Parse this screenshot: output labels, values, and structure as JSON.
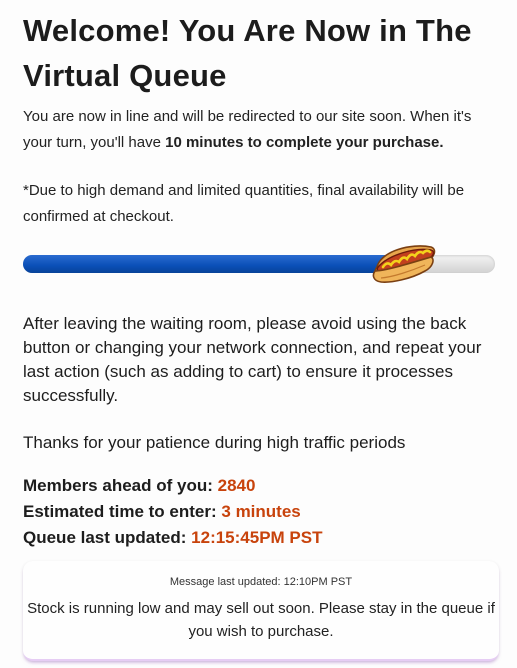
{
  "header": {
    "title": "Welcome! You Are Now in The Virtual Queue"
  },
  "intro": {
    "text_before": "You are now in line and will be redirected to our site soon. When it's your turn, you'll have ",
    "text_bold": "10 minutes to complete your purchase."
  },
  "disclaimer": "*Due to high demand and limited quantities, final availability will be confirmed at checkout.",
  "progress": {
    "fraction": 0.8,
    "icon": "hotdog-icon",
    "fill_color": "#0a4fb7",
    "track_color": "#e2e2e2"
  },
  "notice": "After leaving the waiting room, please avoid using the back button or changing your network connection, and repeat your last action (such as adding to cart) to ensure it processes successfully.",
  "thanks": "Thanks for your patience during high traffic periods",
  "stats": {
    "members_label": "Members ahead of you:",
    "members_value": "2840",
    "time_label": "Estimated time to enter:",
    "time_value": "3 minutes",
    "updated_label": "Queue last updated:",
    "updated_value": "12:15:45PM PST",
    "value_color": "#c8430c"
  },
  "message": {
    "timestamp": "Message last updated: 12:10PM PST",
    "text": "Stock is running low and may sell out soon. Please stay in the queue if you wish to purchase."
  }
}
